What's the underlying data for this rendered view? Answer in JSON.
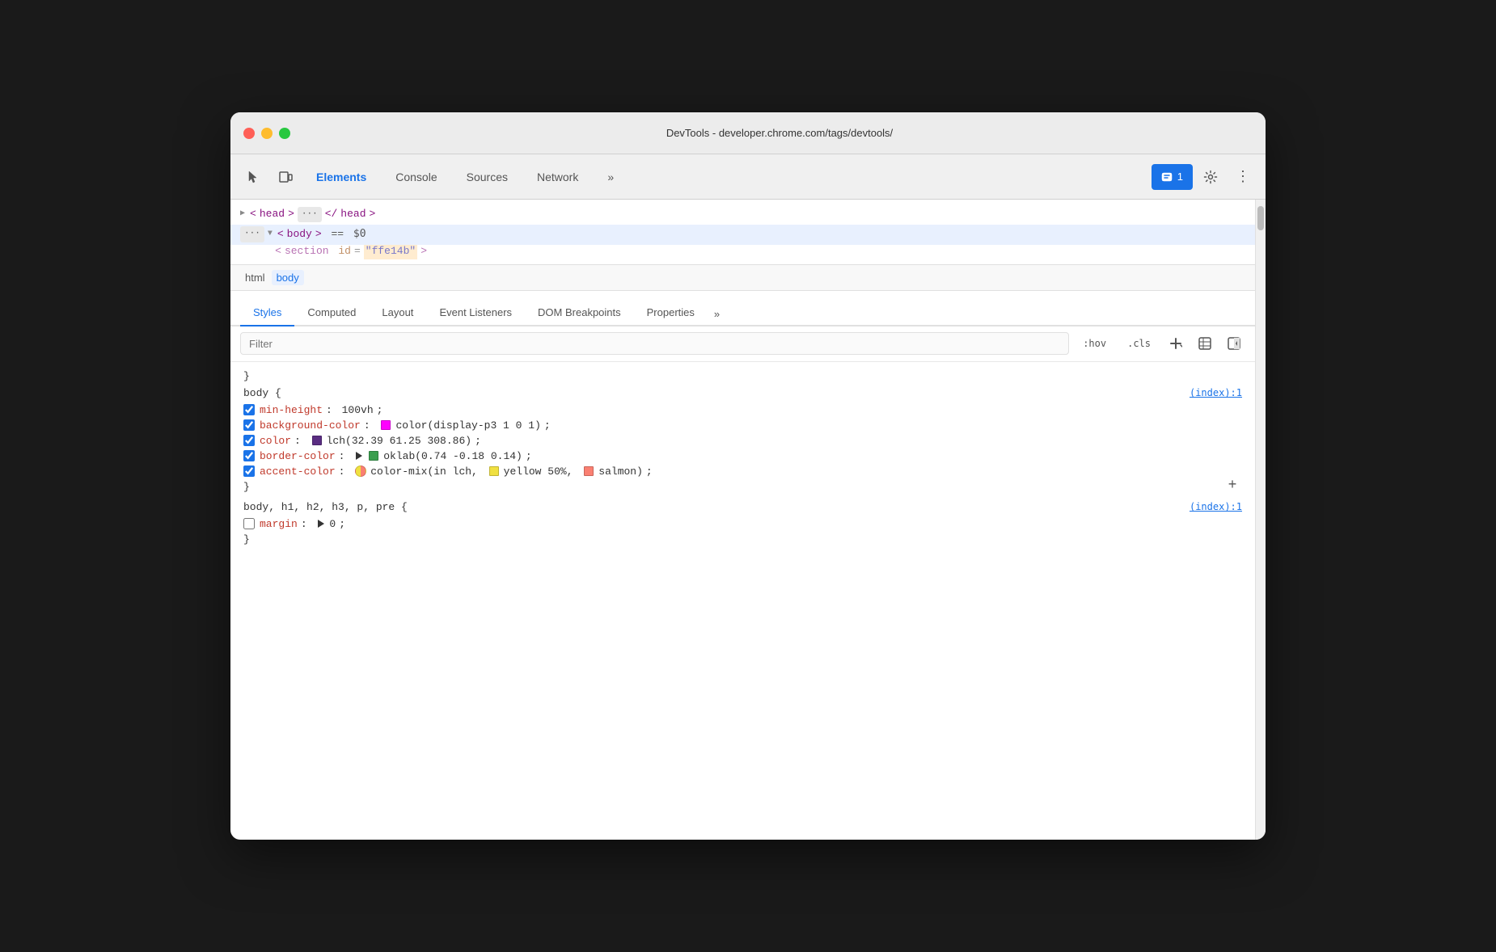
{
  "window": {
    "title": "DevTools - developer.chrome.com/tags/devtools/"
  },
  "traffic_lights": {
    "red_label": "close",
    "yellow_label": "minimize",
    "green_label": "maximize"
  },
  "devtools_tabs": {
    "cursor_icon": "⬡",
    "tabs": [
      {
        "id": "elements",
        "label": "Elements",
        "active": true
      },
      {
        "id": "console",
        "label": "Console",
        "active": false
      },
      {
        "id": "sources",
        "label": "Sources",
        "active": false
      },
      {
        "id": "network",
        "label": "Network",
        "active": false
      },
      {
        "id": "more",
        "label": "»",
        "active": false
      }
    ],
    "badge_count": "1",
    "gear_icon": "⚙",
    "more_icon": "⋮"
  },
  "html_tree": {
    "rows": [
      {
        "indent": 0,
        "content": "▶ <head> ··· </head>",
        "selected": false
      },
      {
        "indent": 0,
        "content": "··· ▼ <body> == $0",
        "selected": true
      }
    ]
  },
  "breadcrumb": {
    "items": [
      {
        "id": "html",
        "label": "html",
        "selected": false
      },
      {
        "id": "body",
        "label": "body",
        "selected": true
      }
    ]
  },
  "styles_panel": {
    "tabs": [
      {
        "id": "styles",
        "label": "Styles",
        "active": true
      },
      {
        "id": "computed",
        "label": "Computed",
        "active": false
      },
      {
        "id": "layout",
        "label": "Layout",
        "active": false
      },
      {
        "id": "event_listeners",
        "label": "Event Listeners",
        "active": false
      },
      {
        "id": "dom_breakpoints",
        "label": "DOM Breakpoints",
        "active": false
      },
      {
        "id": "properties",
        "label": "Properties",
        "active": false
      },
      {
        "id": "more",
        "label": "»",
        "active": false
      }
    ],
    "filter": {
      "placeholder": "Filter",
      "value": ""
    },
    "filter_buttons": [
      {
        "id": "hov",
        "label": ":hov"
      },
      {
        "id": "cls",
        "label": ".cls"
      },
      {
        "id": "add",
        "label": "+"
      },
      {
        "id": "force_element",
        "label": "⊞"
      },
      {
        "id": "toggle_light",
        "label": "◁"
      }
    ],
    "css_rules": [
      {
        "id": "rule1",
        "brace_before": "}",
        "selector": "body {",
        "source_link": "(index):1",
        "properties": [
          {
            "id": "min-height",
            "checked": true,
            "name": "min-height",
            "value": "100vh",
            "semicolon": ";"
          },
          {
            "id": "background-color",
            "checked": true,
            "name": "background-color",
            "value": "color(display-p3 1 0 1)",
            "semicolon": ";",
            "swatch": {
              "type": "solid",
              "color": "#ff00ff"
            }
          },
          {
            "id": "color",
            "checked": true,
            "name": "color",
            "value": "lch(32.39 61.25 308.86)",
            "semicolon": ";",
            "swatch": {
              "type": "solid",
              "color": "#5a2d82"
            }
          },
          {
            "id": "border-color",
            "checked": true,
            "name": "border-color",
            "value": "oklab(0.74 -0.18 0.14)",
            "semicolon": ";",
            "swatch": {
              "type": "triangle_solid",
              "color": "#3a9e4e"
            }
          },
          {
            "id": "accent-color",
            "checked": true,
            "name": "accent-color",
            "value": "color-mix(in lch, yellow 50%, salmon)",
            "semicolon": ";",
            "swatch": {
              "type": "mix",
              "color1": "#f0e040",
              "color2": "#fa8072"
            },
            "inner_swatches": [
              {
                "color": "#f0e040"
              },
              {
                "color": "#fa8072"
              }
            ]
          }
        ],
        "brace_after": "}"
      },
      {
        "id": "rule2",
        "selector": "body, h1, h2, h3, p, pre {",
        "source_link": "(index):1",
        "properties": [
          {
            "id": "margin",
            "checked": false,
            "name": "margin",
            "value": "0",
            "semicolon": ";",
            "has_triangle": true
          }
        ],
        "brace_after": "}"
      }
    ],
    "add_rule_btn": "+"
  }
}
